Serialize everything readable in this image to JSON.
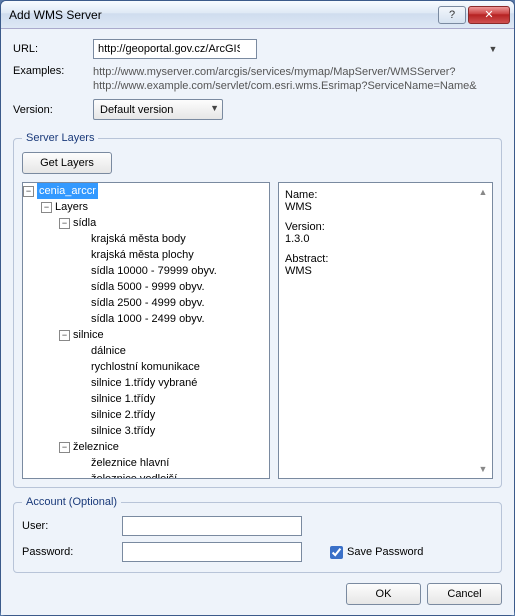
{
  "window": {
    "title": "Add WMS Server"
  },
  "labels": {
    "url": "URL:",
    "examples": "Examples:",
    "version": "Version:",
    "server_layers": "Server Layers",
    "account": "Account (Optional)",
    "user": "User:",
    "password": "Password:",
    "save_password": "Save Password"
  },
  "url": {
    "value": "http://geoportal.gov.cz/ArcGIS/services/CENIA/cenia_arccr/MapServer/WMSSe"
  },
  "examples": {
    "line1": "http://www.myserver.com/arcgis/services/mymap/MapServer/WMSServer?",
    "line2": "http://www.example.com/servlet/com.esri.wms.Esrimap?ServiceName=Name&"
  },
  "version": {
    "value": "Default version"
  },
  "buttons": {
    "get_layers": "Get Layers",
    "ok": "OK",
    "cancel": "Cancel",
    "help": "?",
    "close": "✕"
  },
  "tree": {
    "root": "cenia_arccr",
    "layers_label": "Layers",
    "groups": [
      {
        "name": "sídla",
        "items": [
          "krajská města body",
          "krajská města plochy",
          "sídla 10000 - 79999 obyv.",
          "sídla 5000 - 9999 obyv.",
          "sídla 2500 - 4999 obyv.",
          "sídla 1000 - 2499 obyv."
        ]
      },
      {
        "name": "silnice",
        "items": [
          "dálnice",
          "rychlostní komunikace",
          "silnice 1.třídy vybrané",
          "silnice 1.třídy",
          "silnice 2.třídy",
          "silnice 3.třídy"
        ]
      },
      {
        "name": "železnice",
        "items": [
          "železnice hlavní",
          "železnice vedlejší"
        ]
      }
    ]
  },
  "info": {
    "name_label": "Name:",
    "name_value": "WMS",
    "version_label": "Version:",
    "version_value": "1.3.0",
    "abstract_label": "Abstract:",
    "abstract_value": "WMS"
  },
  "account": {
    "user": "",
    "password": "",
    "save_password_checked": true
  }
}
